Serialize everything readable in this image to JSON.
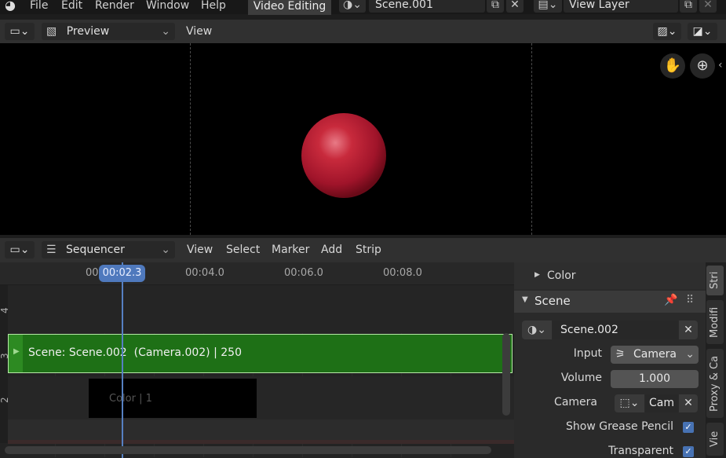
{
  "topbar": {
    "menus": [
      "File",
      "Edit",
      "Render",
      "Window",
      "Help"
    ],
    "workspace_tab": "Video Editing",
    "scene_name": "Scene.001",
    "view_layer": "View Layer"
  },
  "preview_header": {
    "mode": "Preview",
    "view_menu": "View"
  },
  "sequencer_header": {
    "editor": "Sequencer",
    "menus": [
      "View",
      "Select",
      "Marker",
      "Add",
      "Strip"
    ]
  },
  "timeline": {
    "ticks": [
      "00",
      "00:04.0",
      "00:06.0",
      "00:08.0"
    ],
    "current_frame": "00:02.3",
    "channels": [
      "4",
      "3",
      "2"
    ],
    "strips": [
      {
        "label": "Scene: Scene.002  (Camera.002) | 250",
        "color": "#1e7016"
      },
      {
        "label": "Color | 1",
        "color": "#000000"
      }
    ]
  },
  "sidebar": {
    "color_panel": "Color",
    "scene_panel": "Scene",
    "scene_field": "Scene.002",
    "input_label": "Input",
    "input_value": "Camera",
    "volume_label": "Volume",
    "volume_value": "1.000",
    "camera_label": "Camera",
    "camera_value": "Cam",
    "grease_pencil_label": "Show Grease Pencil",
    "grease_pencil_checked": true,
    "transparent_label": "Transparent",
    "transparent_checked": true
  },
  "side_tabs": [
    "Stri",
    "Modifi",
    "Proxy & Ca",
    "Vie"
  ],
  "colors": {
    "accent": "#4772b3",
    "scene_strip": "#1e7016",
    "playhead": "#5680c2",
    "sphere": "#b0182a"
  },
  "icons": [
    "blender-logo-icon",
    "scene-icon",
    "copy-icon",
    "close-icon",
    "render-layers-icon",
    "editor-type-icon",
    "image-icon",
    "overlay-icon",
    "gizmo-icon",
    "hand-pan-icon",
    "zoom-icon",
    "sequencer-icon",
    "pin-icon",
    "drag-grip-icon",
    "camera-icon",
    "object-icon",
    "checkbox-icon"
  ]
}
